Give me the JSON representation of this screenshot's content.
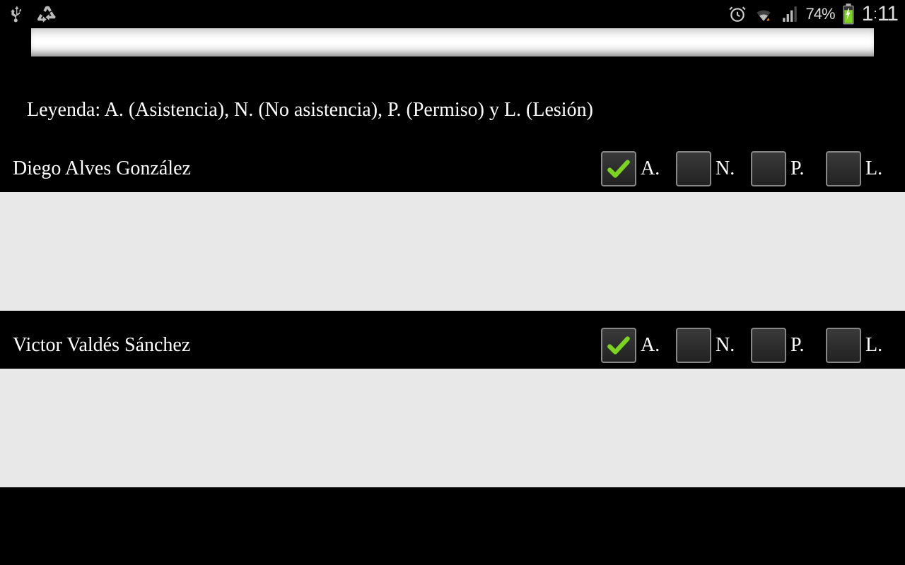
{
  "status": {
    "battery_pct": "74%",
    "time_h": "1",
    "time_m": "11"
  },
  "legend": "Leyenda: A. (Asistencia), N. (No asistencia), P. (Permiso) y L. (Lesión)",
  "labels": {
    "a": "A.",
    "n": "N.",
    "p": "P.",
    "l": "L."
  },
  "players": [
    {
      "name": "Diego Alves González",
      "a": true,
      "n": false,
      "p": false,
      "l": false
    },
    {
      "name": "Victor Valdés Sánchez",
      "a": true,
      "n": false,
      "p": false,
      "l": false
    }
  ]
}
